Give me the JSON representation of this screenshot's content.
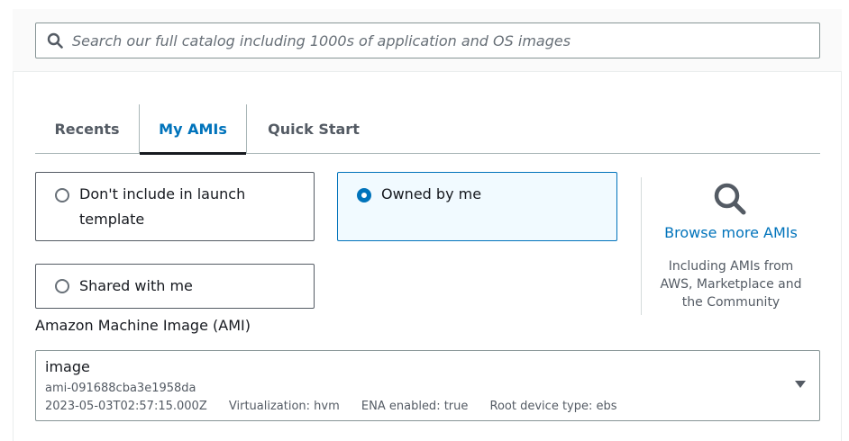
{
  "search": {
    "placeholder": "Search our full catalog including 1000s of application and OS images",
    "value": ""
  },
  "tabs": [
    {
      "label": "Recents",
      "active": false
    },
    {
      "label": "My AMIs",
      "active": true
    },
    {
      "label": "Quick Start",
      "active": false
    }
  ],
  "options": {
    "dont_include": {
      "line1": "Don't include in launch",
      "line2": "template",
      "selected": false
    },
    "owned_by_me": {
      "label": "Owned by me",
      "selected": true
    },
    "shared_with_me": {
      "label": "Shared with me",
      "selected": false
    }
  },
  "browse": {
    "link": "Browse more AMIs",
    "description_lines": [
      "Including AMIs from",
      "AWS, Marketplace and",
      "the Community"
    ]
  },
  "ami": {
    "label": "Amazon Machine Image (AMI)",
    "name": "image",
    "id": "ami-091688cba3e1958da",
    "created": "2023-05-03T02:57:15.000Z",
    "virtualization": "Virtualization: hvm",
    "ena": "ENA enabled: true",
    "root_device": "Root device type: ebs"
  },
  "colors": {
    "accent": "#0073bb",
    "selected_bg": "#f1faff",
    "text": "#16191f",
    "muted": "#545b64"
  }
}
